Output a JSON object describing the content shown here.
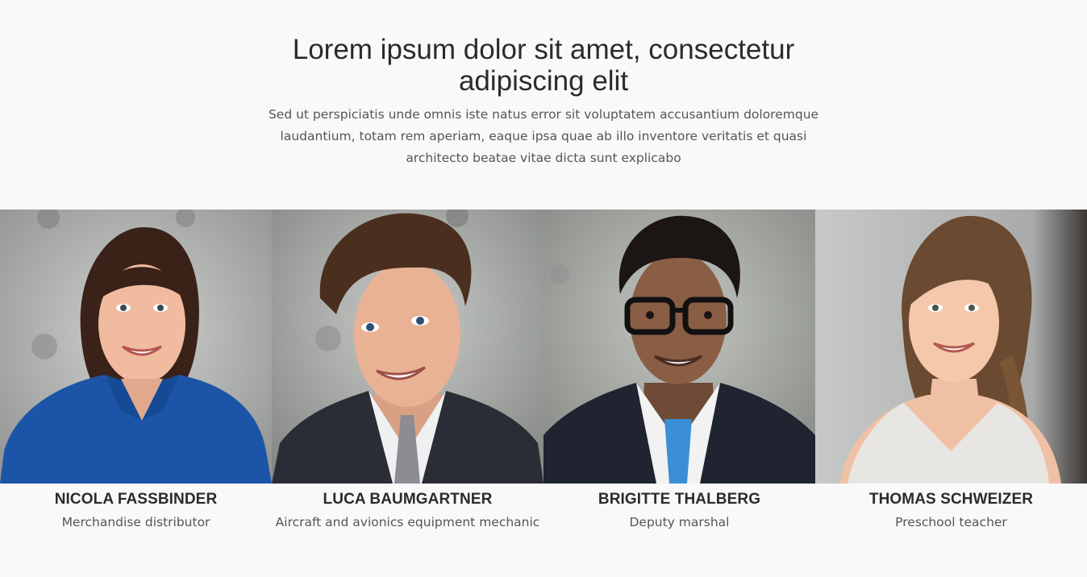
{
  "section": {
    "heading_line1": "Lorem ipsum dolor sit amet, consectetur",
    "heading_line2": "adipiscing elit",
    "intro": "Sed ut perspiciatis unde omnis iste natus error sit voluptatem accusantium doloremque laudantium, totam rem aperiam, eaque ipsa quae ab illo inventore veritatis et quasi architecto beatae vitae dicta sunt explicabo"
  },
  "team": [
    {
      "name": "NICOLA FASSBINDER",
      "role": "Merchandise distributor",
      "photo_icon": "portrait-woman-blue-shirt",
      "shirt_color": "#1c55a8"
    },
    {
      "name": "LUCA BAUMGARTNER",
      "role": "Aircraft and avionics equipment mechanic",
      "photo_icon": "portrait-man-suit",
      "shirt_color": "#2a2d36"
    },
    {
      "name": "BRIGITTE THALBERG",
      "role": "Deputy marshal",
      "photo_icon": "portrait-man-glasses",
      "shirt_color": "#1f2430"
    },
    {
      "name": "THOMAS SCHWEIZER",
      "role": "Preschool teacher",
      "photo_icon": "portrait-woman-white-top",
      "shirt_color": "#e8e6e3"
    }
  ],
  "colors": {
    "background": "#f9f9f9",
    "heading": "#2b2b2b",
    "body_text": "#555555",
    "photo_backdrop": "#b9bcbb"
  }
}
